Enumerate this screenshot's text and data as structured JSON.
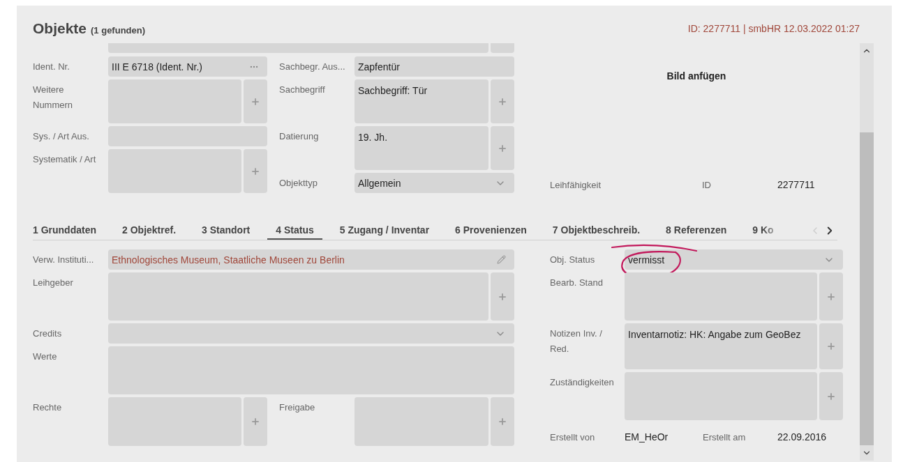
{
  "header": {
    "title": "Objekte",
    "count": "(1 gefunden)",
    "record": "ID: 2277711 | smbHR 12.03.2022 01:27"
  },
  "top": {
    "columns": [
      [
        {
          "label": "Ident. Nr.",
          "kind": "ident",
          "value": "III E 6718 (Ident. Nr.)"
        },
        {
          "label": "Weitere Nummern",
          "kind": "multi"
        },
        {
          "label": "Sys. / Art Aus.",
          "kind": "input"
        },
        {
          "label": "Systematik / Art",
          "kind": "multi"
        }
      ],
      [
        {
          "label": "Sachbegr. Aus...",
          "kind": "input",
          "value": "Zapfentür"
        },
        {
          "label": "Sachbegriff",
          "kind": "multi",
          "value": "Sachbegriff: Tür"
        },
        {
          "label": "Datierung",
          "kind": "multi",
          "value": "19. Jh."
        },
        {
          "label": "Objekttyp",
          "kind": "select",
          "value": "Allgemein"
        }
      ]
    ],
    "image_action": "Bild anfügen",
    "info": [
      {
        "kind": "label",
        "text": "Leihfähigkeit"
      },
      {
        "kind": "label",
        "text": "ID"
      },
      {
        "kind": "value",
        "text": "2277711"
      }
    ]
  },
  "tabs": [
    {
      "label": "1 Grunddaten",
      "selected": false
    },
    {
      "label": "2 Objektref.",
      "selected": false
    },
    {
      "label": "3 Standort",
      "selected": false
    },
    {
      "label": "4 Status",
      "selected": true
    },
    {
      "label": "5 Zugang / Inventar",
      "selected": false
    },
    {
      "label": "6 Provenienzen",
      "selected": false
    },
    {
      "label": "7 Objektbeschreib.",
      "selected": false
    },
    {
      "label": "8 Referenzen",
      "selected": false
    },
    {
      "label": "9 Ko",
      "selected": false
    }
  ],
  "tab_scroll": [
    {
      "disabled": true
    },
    {
      "disabled": false
    }
  ],
  "status": {
    "left": [
      [
        {
          "label": "Verw. Instituti...",
          "kind": "link",
          "value": "Ethnologisches Museum, Staatliche Museen zu Berlin"
        }
      ],
      [
        {
          "label": "Leihgeber",
          "kind": "multi"
        }
      ],
      [
        {
          "label": "Credits",
          "kind": "select"
        }
      ],
      [
        {
          "label": "Werte",
          "kind": "area"
        }
      ],
      [
        {
          "label": "Rechte",
          "kind": "multi"
        },
        {
          "label": "Freigabe",
          "kind": "multi"
        }
      ]
    ],
    "right": [
      {
        "label": "Obj. Status",
        "kind": "select",
        "value": "vermisst",
        "annotated": true
      },
      {
        "label": "Bearb. Stand",
        "kind": "multi"
      },
      {
        "label": "Notizen Inv. / Red.",
        "kind": "multi",
        "value": "Inventarnotiz: HK: Angabe zum GeoBez"
      },
      {
        "label": "Zuständigkeiten",
        "kind": "multi"
      }
    ],
    "created": [
      {
        "kind": "label",
        "text": "Erstellt von"
      },
      {
        "kind": "value",
        "text": "EM_HeOr"
      },
      {
        "kind": "label",
        "text": "Erstellt am"
      },
      {
        "kind": "value",
        "text": "22.09.2016"
      }
    ]
  }
}
